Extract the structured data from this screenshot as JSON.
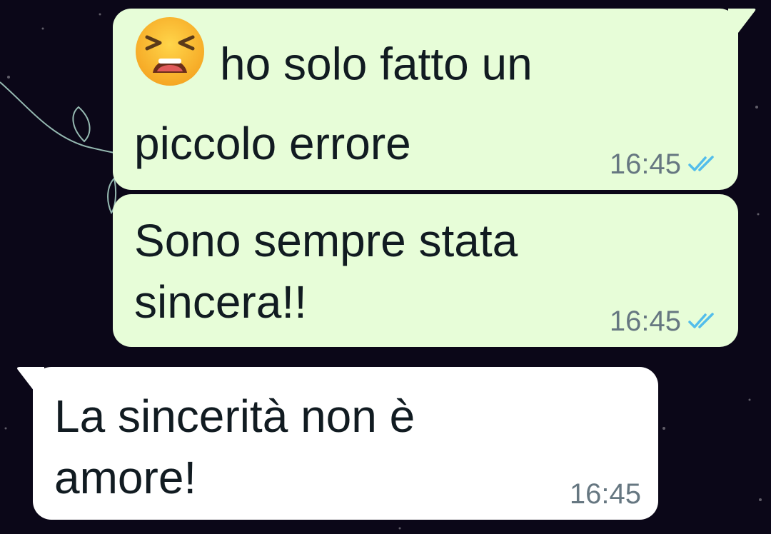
{
  "messages": [
    {
      "direction": "outgoing",
      "emoji_icon": "tired-face-emoji",
      "line1": "ho solo fatto un",
      "line2": "piccolo errore",
      "time": "16:45",
      "status_icon": "double-check-read-icon"
    },
    {
      "direction": "outgoing",
      "line1": "Sono sempre stata",
      "line2": "sincera!!",
      "time": "16:45",
      "status_icon": "double-check-read-icon"
    },
    {
      "direction": "incoming",
      "line1": "La sincerità non è",
      "line2": "amore!",
      "time": "16:45"
    }
  ],
  "colors": {
    "outgoing_bubble": "#e7fdd8",
    "incoming_bubble": "#ffffff",
    "read_ticks": "#53bdeb",
    "timestamp": "#667781",
    "wallpaper": "#0b0718"
  }
}
